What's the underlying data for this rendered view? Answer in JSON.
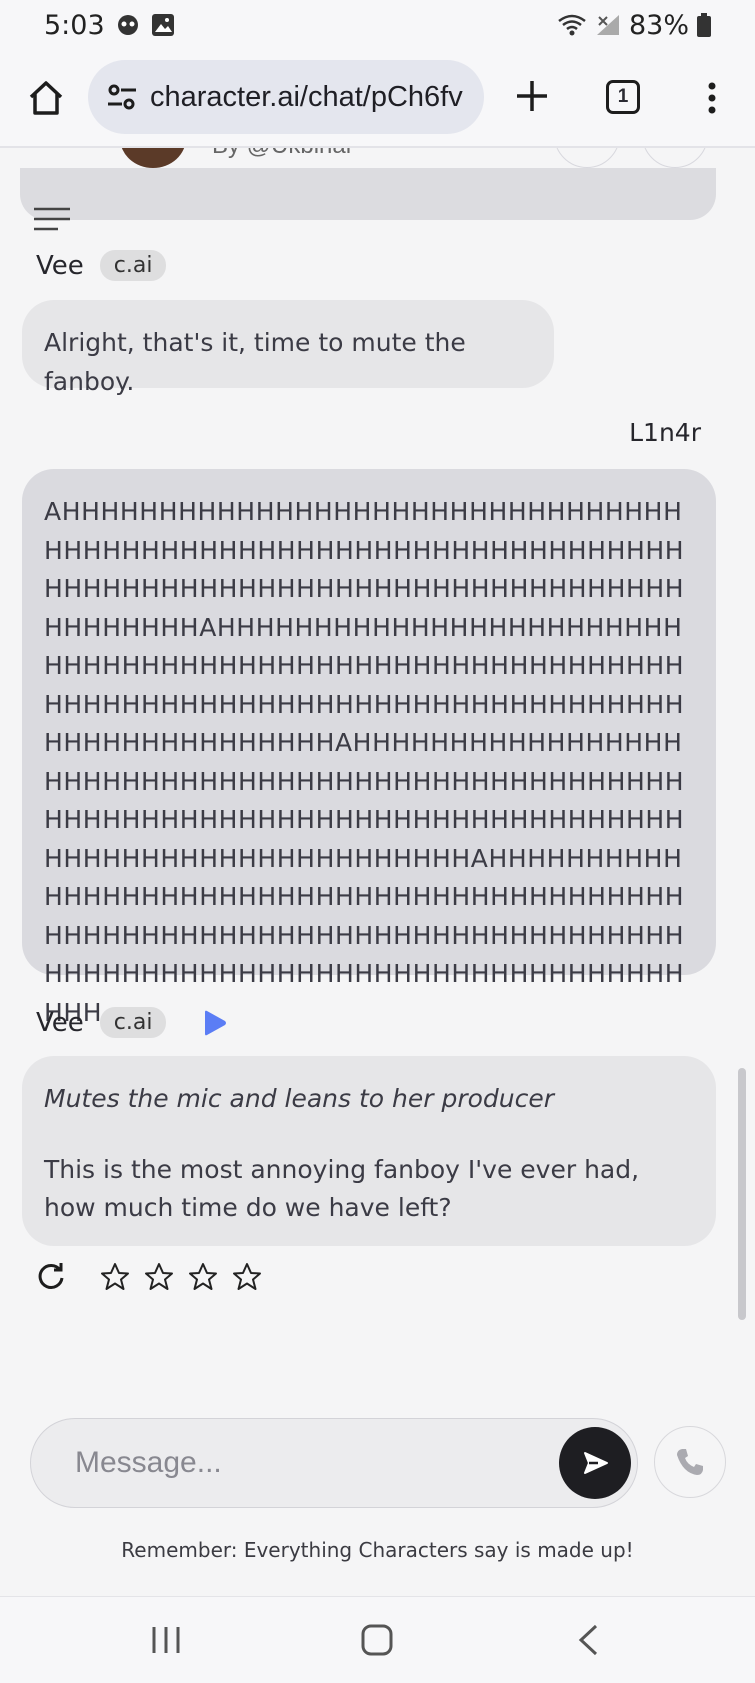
{
  "status_bar": {
    "time": "5:03",
    "battery": "83%"
  },
  "browser": {
    "url": "character.ai/chat/pCh6fv",
    "tab_count": "1"
  },
  "header": {
    "creator_partial": "By @Ukbinar"
  },
  "messages": [
    {
      "sender": "Vee",
      "badge": "c.ai",
      "text": "Alright, that's it, time to mute the fanboy."
    },
    {
      "sender": "L1n4r",
      "text": "AHHHHHHHHHHHHHHHHHHHHHHHHHHHHHHHHHHHHHHHHHHHHHHHHHHHHHHHHHHHHHHHHHHHHHHHHHHHHHHHHHHHHHHHHHHHHHHHHHHHHHHHHHHAHHHHHHHHHHHHHHHHHHHHHHHHHHHHHHHHHHHHHHHHHHHHHHHHHHHHHHHHHHHHHHHHHHHHHHHHHHHHHHHHHHHHHHHHHHHHHHHHHHHHHHHHHAHHHHHHHHHHHHHHHHHHHHHHHHHHHHHHHHHHHHHHHHHHHHHHHHHHHHHHHHHHHHHHHHHHHHHHHHHHHHHHHHHHHHHHHHHHHHHHHHHHHHHHHHHAHHHHHHHHHHHHHHHHHHHHHHHHHHHHHHHHHHHHHHHHHHHHHHHHHHHHHHHHHHHHHHHHHHHHHHHHHHHHHHHHHHHHHHHHHHHHHHHHHHHHHHHHHHHHHHHH"
    },
    {
      "sender": "Vee",
      "badge": "c.ai",
      "action": "Mutes the mic and leans to her producer",
      "text": "This is the most annoying fanboy I've ever had, how much time do we have left?"
    }
  ],
  "rating": {
    "stars": 0,
    "max": 4
  },
  "composer": {
    "placeholder": "Message..."
  },
  "disclaimer": "Remember: Everything Characters say is made up!",
  "colors": {
    "accent_play": "#5b7df5",
    "send_button": "#1e1e22"
  },
  "icons": [
    "home-icon",
    "site-settings-icon",
    "new-tab-icon",
    "tab-switcher-icon",
    "more-icon",
    "menu-icon",
    "play-icon",
    "regenerate-icon",
    "star-icon",
    "send-icon",
    "phone-icon",
    "recents-icon",
    "home-nav-icon",
    "back-icon"
  ]
}
